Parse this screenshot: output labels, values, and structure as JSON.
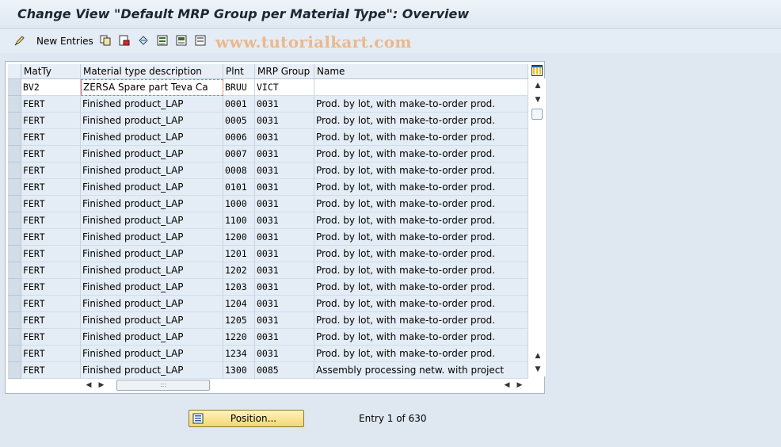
{
  "window": {
    "title": "Change View \"Default MRP Group per Material Type\": Overview"
  },
  "toolbar": {
    "new_entries_label": "New Entries",
    "watermark": "www.tutorialkart.com"
  },
  "table": {
    "headers": [
      "MatTy",
      "Material type description",
      "Plnt",
      "MRP Group",
      "Name"
    ],
    "rows": [
      [
        "BV2",
        "ZERSA Spare part Teva Ca",
        "BRUU",
        "VICT",
        ""
      ],
      [
        "FERT",
        "Finished product_LAP",
        "0001",
        "0031",
        "Prod. by lot, with make-to-order prod."
      ],
      [
        "FERT",
        "Finished product_LAP",
        "0005",
        "0031",
        "Prod. by lot, with make-to-order prod."
      ],
      [
        "FERT",
        "Finished product_LAP",
        "0006",
        "0031",
        "Prod. by lot, with make-to-order prod."
      ],
      [
        "FERT",
        "Finished product_LAP",
        "0007",
        "0031",
        "Prod. by lot, with make-to-order prod."
      ],
      [
        "FERT",
        "Finished product_LAP",
        "0008",
        "0031",
        "Prod. by lot, with make-to-order prod."
      ],
      [
        "FERT",
        "Finished product_LAP",
        "0101",
        "0031",
        "Prod. by lot, with make-to-order prod."
      ],
      [
        "FERT",
        "Finished product_LAP",
        "1000",
        "0031",
        "Prod. by lot, with make-to-order prod."
      ],
      [
        "FERT",
        "Finished product_LAP",
        "1100",
        "0031",
        "Prod. by lot, with make-to-order prod."
      ],
      [
        "FERT",
        "Finished product_LAP",
        "1200",
        "0031",
        "Prod. by lot, with make-to-order prod."
      ],
      [
        "FERT",
        "Finished product_LAP",
        "1201",
        "0031",
        "Prod. by lot, with make-to-order prod."
      ],
      [
        "FERT",
        "Finished product_LAP",
        "1202",
        "0031",
        "Prod. by lot, with make-to-order prod."
      ],
      [
        "FERT",
        "Finished product_LAP",
        "1203",
        "0031",
        "Prod. by lot, with make-to-order prod."
      ],
      [
        "FERT",
        "Finished product_LAP",
        "1204",
        "0031",
        "Prod. by lot, with make-to-order prod."
      ],
      [
        "FERT",
        "Finished product_LAP",
        "1205",
        "0031",
        "Prod. by lot, with make-to-order prod."
      ],
      [
        "FERT",
        "Finished product_LAP",
        "1220",
        "0031",
        "Prod. by lot, with make-to-order prod."
      ],
      [
        "FERT",
        "Finished product_LAP",
        "1234",
        "0031",
        "Prod. by lot, with make-to-order prod."
      ],
      [
        "FERT",
        "Finished product_LAP",
        "1300",
        "0085",
        "Assembly processing netw. with project"
      ]
    ]
  },
  "footer": {
    "position_button_label": "Position...",
    "entry_text": "Entry 1 of 630"
  },
  "icons": [
    "edit-icon",
    "copy-icon",
    "delete-icon",
    "undo-icon",
    "select-all-icon",
    "select-block-icon",
    "deselect-icon",
    "table-settings-icon",
    "position-icon"
  ]
}
